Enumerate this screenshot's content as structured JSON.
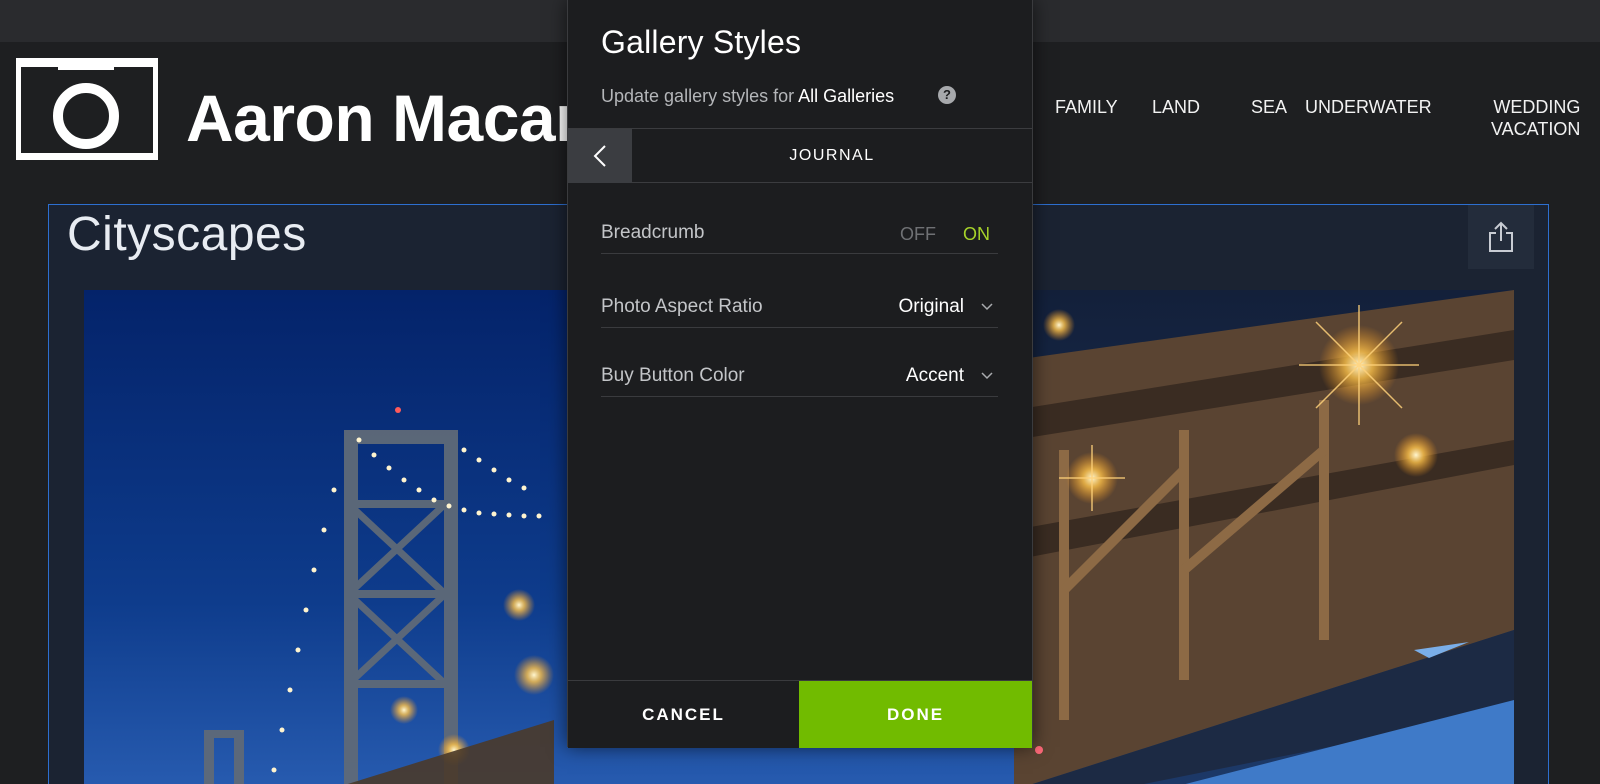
{
  "site": {
    "logo_text": "Aaron Macar",
    "nav": [
      "FAMILY",
      "LAND",
      "SEA",
      "UNDERWATER"
    ],
    "nav_wedding_line1": "WEDDING",
    "nav_wedding_line2": "VACATION",
    "logo_icon": "camera-icon"
  },
  "gallery": {
    "title": "Cityscapes",
    "share_icon": "share-icon",
    "border_color": "#2d6fd0"
  },
  "modal": {
    "title": "Gallery Styles",
    "subtitle_prefix": "Update gallery styles for ",
    "subtitle_target": "All Galleries",
    "help_glyph": "?",
    "tab": "JOURNAL",
    "back_icon": "chevron-left-icon",
    "settings": {
      "breadcrumb": {
        "label": "Breadcrumb",
        "off": "OFF",
        "on": "ON",
        "value": "ON"
      },
      "aspect": {
        "label": "Photo Aspect Ratio",
        "value": "Original"
      },
      "buy": {
        "label": "Buy Button Color",
        "value": "Accent"
      }
    },
    "cancel_label": "CANCEL",
    "done_label": "DONE",
    "accent_color": "#71bb00",
    "on_color": "#a6d22a"
  }
}
